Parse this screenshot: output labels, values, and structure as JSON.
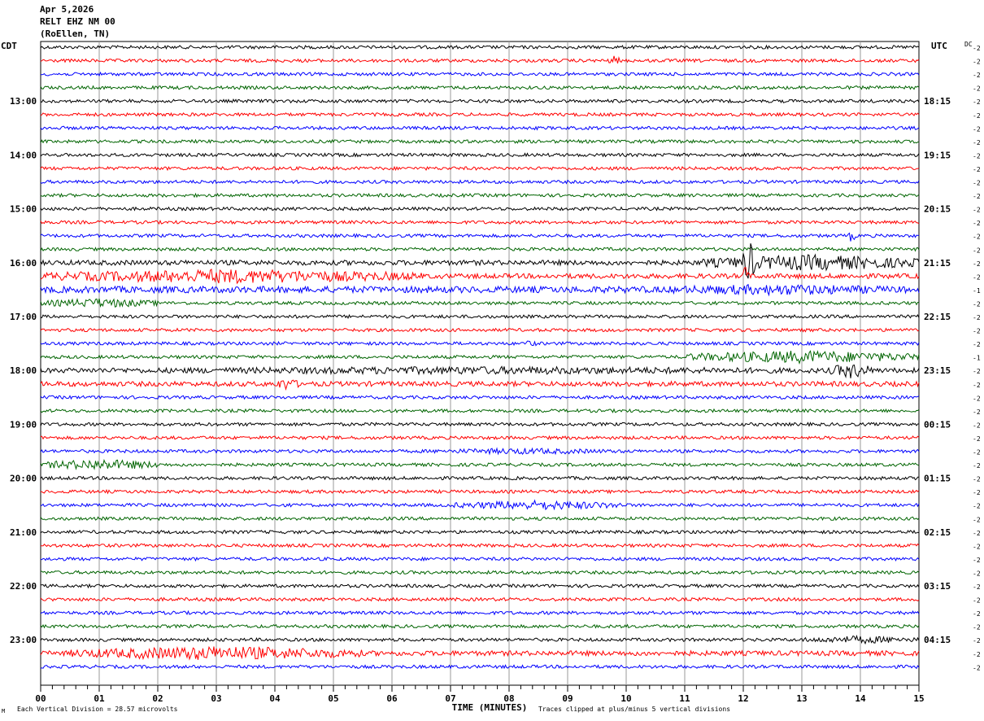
{
  "header": {
    "date": "Apr 5,2026",
    "station": "RELT EHZ NM 00",
    "location": "(RoEllen, TN)"
  },
  "chart_data": {
    "type": "line",
    "subtype": "helicorder",
    "left_axis_title": "CDT",
    "right_axis_title": "UTC",
    "dc_label": "DC",
    "xlabel": "TIME (MINUTES)",
    "x_ticks": [
      "00",
      "01",
      "02",
      "03",
      "04",
      "05",
      "06",
      "07",
      "08",
      "09",
      "10",
      "11",
      "12",
      "13",
      "14",
      "15"
    ],
    "xlim": [
      0,
      15
    ],
    "lines_per_hour": 4,
    "trace_colors": [
      "#000000",
      "#ff0000",
      "#0000ff",
      "#006400"
    ],
    "left_time_labels": [
      "13:00",
      "14:00",
      "15:00",
      "16:00",
      "17:00",
      "18:00",
      "19:00",
      "20:00",
      "21:00",
      "22:00",
      "23:00"
    ],
    "right_time_labels": [
      "18:15",
      "19:15",
      "20:15",
      "21:15",
      "22:15",
      "23:15",
      "00:15",
      "01:15",
      "02:15",
      "03:15",
      "04:15"
    ],
    "first_label_trace": 4,
    "dc_offsets": [
      "-2",
      "-2",
      "-2",
      "-2",
      "-2",
      "-2",
      "-2",
      "-2",
      "-2",
      "-2",
      "-2",
      "-2",
      "-2",
      "-2",
      "-2",
      "-2",
      "-2",
      "-2",
      "-1",
      "-2",
      "-2",
      "-2",
      "-2",
      "-1",
      "-2",
      "-2",
      "-2",
      "-2",
      "-2",
      "-2",
      "-2",
      "-2",
      "-2",
      "-2",
      "-2",
      "-2",
      "-2",
      "-2",
      "-2",
      "-2",
      "-2",
      "-2",
      "-2",
      "-2",
      "-2",
      "-2",
      "-2"
    ],
    "scale_note": "Each Vertical Division =   28.57 microvolts",
    "clip_note": "Traces clipped at plus/minus 5 vertical divisions",
    "corner_mark": "M",
    "trace_amplitude": [
      2,
      2,
      2,
      2,
      2,
      2,
      2,
      2,
      2,
      2,
      2,
      2,
      2,
      2,
      2,
      2,
      3,
      3,
      4,
      2,
      2,
      2,
      2,
      2,
      3,
      3,
      2,
      2,
      2,
      2,
      2,
      2,
      2,
      2,
      2,
      2,
      2,
      2,
      2,
      2,
      2,
      2,
      2,
      2,
      2,
      3,
      2
    ],
    "events": [
      {
        "trace": 1,
        "start": 9.7,
        "end": 9.9,
        "amp": 6
      },
      {
        "trace": 14,
        "start": 13.8,
        "end": 13.9,
        "amp": 9
      },
      {
        "trace": 16,
        "start": 11.3,
        "end": 15.0,
        "amp": 10
      },
      {
        "trace": 16,
        "start": 12.0,
        "end": 12.2,
        "amp": 28
      },
      {
        "trace": 17,
        "start": 0.0,
        "end": 6.5,
        "amp": 9
      },
      {
        "trace": 17,
        "start": 12.0,
        "end": 12.1,
        "amp": 16
      },
      {
        "trace": 18,
        "start": 10.2,
        "end": 15.0,
        "amp": 7
      },
      {
        "trace": 19,
        "start": 0.0,
        "end": 2.0,
        "amp": 6
      },
      {
        "trace": 22,
        "start": 8.2,
        "end": 8.5,
        "amp": 4
      },
      {
        "trace": 23,
        "start": 11.0,
        "end": 15.0,
        "amp": 8
      },
      {
        "trace": 24,
        "start": 0.0,
        "end": 15.0,
        "amp": 5
      },
      {
        "trace": 24,
        "start": 13.5,
        "end": 14.2,
        "amp": 10
      },
      {
        "trace": 25,
        "start": 4.0,
        "end": 4.4,
        "amp": 8
      },
      {
        "trace": 30,
        "start": 6.5,
        "end": 10.0,
        "amp": 4
      },
      {
        "trace": 31,
        "start": 0.0,
        "end": 2.0,
        "amp": 7
      },
      {
        "trace": 34,
        "start": 7.0,
        "end": 10.0,
        "amp": 6
      },
      {
        "trace": 45,
        "start": 0.5,
        "end": 5.5,
        "amp": 9
      },
      {
        "trace": 44,
        "start": 13.0,
        "end": 15.0,
        "amp": 5
      }
    ]
  }
}
